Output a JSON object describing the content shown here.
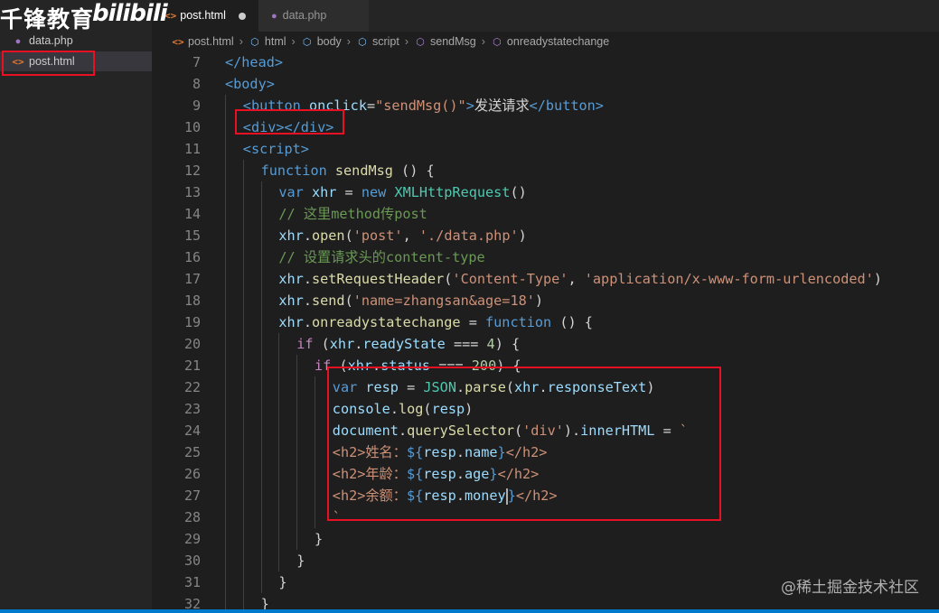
{
  "watermarks": {
    "left_text": "千锋教育",
    "bili_text": "bilibili",
    "bottom_right": "@稀土掘金技术社区"
  },
  "sidebar": {
    "files": [
      {
        "name": "data.php",
        "icon": "php-elephant-icon",
        "active": false
      },
      {
        "name": "post.html",
        "icon": "html-file-icon",
        "active": true
      }
    ]
  },
  "tabs": [
    {
      "label": "post.html",
      "active": true,
      "dirty": true,
      "icon": "html-file-icon"
    },
    {
      "label": "data.php",
      "active": false,
      "dirty": false,
      "icon": "php-elephant-icon"
    }
  ],
  "breadcrumb": [
    {
      "label": "post.html",
      "icon": "html-file-icon"
    },
    {
      "label": "html",
      "icon": "element-cube-icon"
    },
    {
      "label": "body",
      "icon": "element-cube-icon"
    },
    {
      "label": "script",
      "icon": "element-cube-icon"
    },
    {
      "label": "sendMsg",
      "icon": "method-cube-icon"
    },
    {
      "label": "onreadystatechange",
      "icon": "method-cube-icon"
    }
  ],
  "editor": {
    "lines": [
      {
        "n": "7",
        "indent": 0,
        "tokens": [
          [
            "tag",
            "</head>"
          ]
        ]
      },
      {
        "n": "8",
        "indent": 0,
        "tokens": [
          [
            "tag",
            "<body>"
          ]
        ]
      },
      {
        "n": "9",
        "indent": 1,
        "tokens": [
          [
            "tag",
            "<button "
          ],
          [
            "attr",
            "onclick"
          ],
          [
            "plain",
            "="
          ],
          [
            "str",
            "\"sendMsg()\""
          ],
          [
            "tag",
            ">"
          ],
          [
            "plain",
            "发送请求"
          ],
          [
            "tag",
            "</button>"
          ]
        ]
      },
      {
        "n": "10",
        "indent": 1,
        "tokens": [
          [
            "tag",
            "<div></div>"
          ]
        ]
      },
      {
        "n": "11",
        "indent": 1,
        "tokens": [
          [
            "tag",
            "<script>"
          ]
        ]
      },
      {
        "n": "12",
        "indent": 2,
        "tokens": [
          [
            "kw",
            "function "
          ],
          [
            "fn",
            "sendMsg "
          ],
          [
            "plain",
            "() {"
          ]
        ]
      },
      {
        "n": "13",
        "indent": 3,
        "tokens": [
          [
            "kw",
            "var "
          ],
          [
            "var",
            "xhr "
          ],
          [
            "plain",
            "= "
          ],
          [
            "kw",
            "new "
          ],
          [
            "cls",
            "XMLHttpRequest"
          ],
          [
            "plain",
            "()"
          ]
        ]
      },
      {
        "n": "14",
        "indent": 3,
        "tokens": [
          [
            "com",
            "// 这里method传post"
          ]
        ]
      },
      {
        "n": "15",
        "indent": 3,
        "tokens": [
          [
            "var",
            "xhr"
          ],
          [
            "plain",
            "."
          ],
          [
            "fn",
            "open"
          ],
          [
            "plain",
            "("
          ],
          [
            "str",
            "'post'"
          ],
          [
            "plain",
            ", "
          ],
          [
            "str",
            "'./data.php'"
          ],
          [
            "plain",
            ")"
          ]
        ]
      },
      {
        "n": "16",
        "indent": 3,
        "tokens": [
          [
            "com",
            "// 设置请求头的content-type"
          ]
        ]
      },
      {
        "n": "17",
        "indent": 3,
        "tokens": [
          [
            "var",
            "xhr"
          ],
          [
            "plain",
            "."
          ],
          [
            "fn",
            "setRequestHeader"
          ],
          [
            "plain",
            "("
          ],
          [
            "str",
            "'Content-Type'"
          ],
          [
            "plain",
            ", "
          ],
          [
            "str",
            "'application/x-www-form-urlencoded'"
          ],
          [
            "plain",
            ")"
          ]
        ]
      },
      {
        "n": "18",
        "indent": 3,
        "tokens": [
          [
            "var",
            "xhr"
          ],
          [
            "plain",
            "."
          ],
          [
            "fn",
            "send"
          ],
          [
            "plain",
            "("
          ],
          [
            "str",
            "'name=zhangsan&age=18'"
          ],
          [
            "plain",
            ")"
          ]
        ]
      },
      {
        "n": "19",
        "indent": 3,
        "tokens": [
          [
            "var",
            "xhr"
          ],
          [
            "plain",
            "."
          ],
          [
            "fn",
            "onreadystatechange "
          ],
          [
            "plain",
            "= "
          ],
          [
            "kw",
            "function "
          ],
          [
            "plain",
            "() {"
          ]
        ]
      },
      {
        "n": "20",
        "indent": 4,
        "tokens": [
          [
            "ctl",
            "if "
          ],
          [
            "plain",
            "("
          ],
          [
            "var",
            "xhr"
          ],
          [
            "plain",
            "."
          ],
          [
            "var",
            "readyState "
          ],
          [
            "plain",
            "=== "
          ],
          [
            "num",
            "4"
          ],
          [
            "plain",
            ") {"
          ]
        ]
      },
      {
        "n": "21",
        "indent": 5,
        "tokens": [
          [
            "ctl",
            "if "
          ],
          [
            "plain",
            "("
          ],
          [
            "var",
            "xhr"
          ],
          [
            "plain",
            "."
          ],
          [
            "var",
            "status "
          ],
          [
            "plain",
            "=== "
          ],
          [
            "num",
            "200"
          ],
          [
            "plain",
            ") {"
          ]
        ]
      },
      {
        "n": "22",
        "indent": 6,
        "tokens": [
          [
            "kw",
            "var "
          ],
          [
            "var",
            "resp "
          ],
          [
            "plain",
            "= "
          ],
          [
            "cls",
            "JSON"
          ],
          [
            "plain",
            "."
          ],
          [
            "fn",
            "parse"
          ],
          [
            "plain",
            "("
          ],
          [
            "var",
            "xhr"
          ],
          [
            "plain",
            "."
          ],
          [
            "var",
            "responseText"
          ],
          [
            "plain",
            ")"
          ]
        ]
      },
      {
        "n": "23",
        "indent": 6,
        "tokens": [
          [
            "var",
            "console"
          ],
          [
            "plain",
            "."
          ],
          [
            "fn",
            "log"
          ],
          [
            "plain",
            "("
          ],
          [
            "var",
            "resp"
          ],
          [
            "plain",
            ")"
          ]
        ]
      },
      {
        "n": "24",
        "indent": 6,
        "tokens": [
          [
            "var",
            "document"
          ],
          [
            "plain",
            "."
          ],
          [
            "fn",
            "querySelector"
          ],
          [
            "plain",
            "("
          ],
          [
            "str",
            "'div'"
          ],
          [
            "plain",
            ")."
          ],
          [
            "var",
            "innerHTML "
          ],
          [
            "plain",
            "= "
          ],
          [
            "str",
            "`"
          ]
        ]
      },
      {
        "n": "25",
        "indent": 6,
        "tokens": [
          [
            "str",
            "<h2>姓名："
          ],
          [
            "kw",
            "${"
          ],
          [
            "var",
            "resp"
          ],
          [
            "plain",
            "."
          ],
          [
            "var",
            "name"
          ],
          [
            "kw",
            "}"
          ],
          [
            "str",
            "</h2>"
          ]
        ]
      },
      {
        "n": "26",
        "indent": 6,
        "tokens": [
          [
            "str",
            "<h2>年龄："
          ],
          [
            "kw",
            "${"
          ],
          [
            "var",
            "resp"
          ],
          [
            "plain",
            "."
          ],
          [
            "var",
            "age"
          ],
          [
            "kw",
            "}"
          ],
          [
            "str",
            "</h2>"
          ]
        ]
      },
      {
        "n": "27",
        "indent": 6,
        "tokens": [
          [
            "str",
            "<h2>余额："
          ],
          [
            "kw",
            "${"
          ],
          [
            "var",
            "resp"
          ],
          [
            "plain",
            "."
          ],
          [
            "var",
            "money"
          ],
          [
            "cursor",
            ""
          ],
          [
            "kw",
            "}"
          ],
          [
            "str",
            "</h2>"
          ]
        ]
      },
      {
        "n": "28",
        "indent": 6,
        "tokens": [
          [
            "str",
            "`"
          ]
        ]
      },
      {
        "n": "29",
        "indent": 5,
        "tokens": [
          [
            "plain",
            "}"
          ]
        ]
      },
      {
        "n": "30",
        "indent": 4,
        "tokens": [
          [
            "plain",
            "}"
          ]
        ]
      },
      {
        "n": "31",
        "indent": 3,
        "tokens": [
          [
            "plain",
            "}"
          ]
        ]
      },
      {
        "n": "32",
        "indent": 2,
        "tokens": [
          [
            "plain",
            "}"
          ]
        ]
      }
    ]
  },
  "colors": {
    "editor_bg": "#1e1e1e",
    "sidebar_bg": "#252526",
    "highlight_box": "#e81123",
    "status_bar": "#007acc"
  }
}
